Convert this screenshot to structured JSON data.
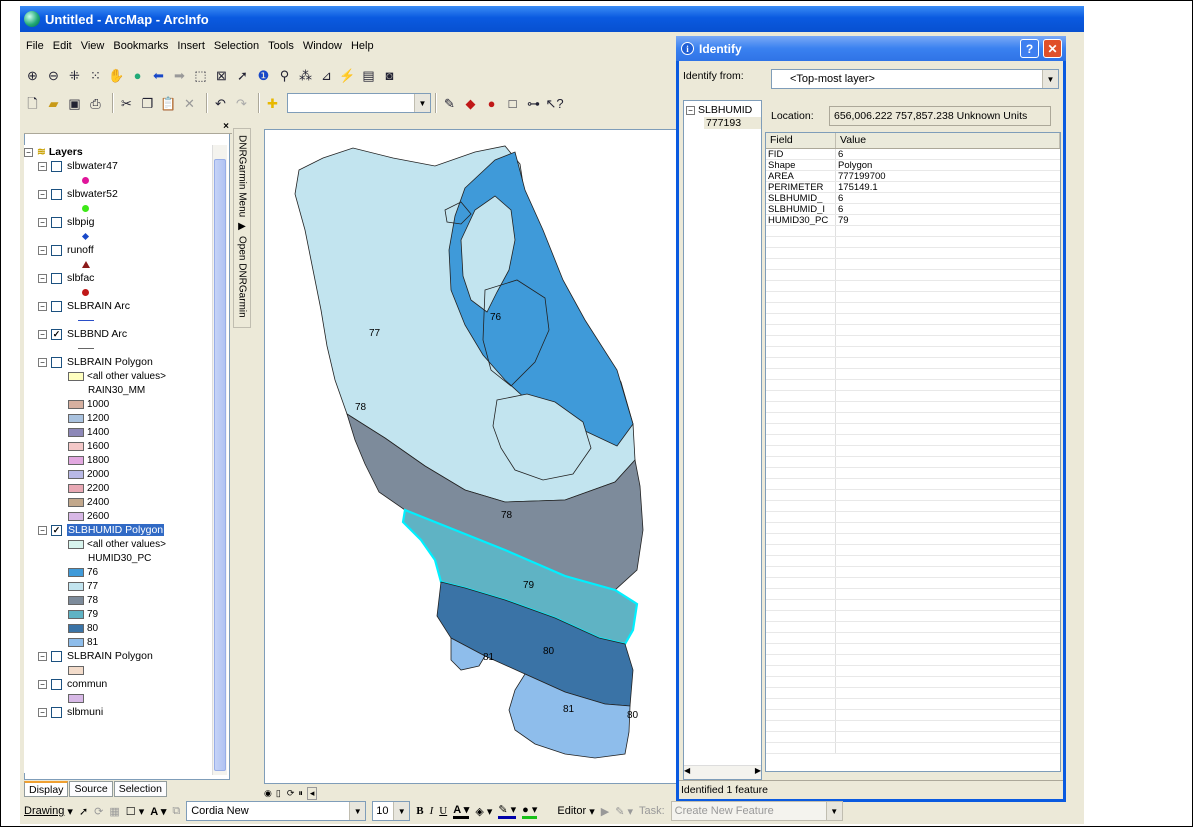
{
  "window": {
    "title": "Untitled - ArcMap - ArcInfo"
  },
  "menu": [
    "File",
    "Edit",
    "View",
    "Bookmarks",
    "Insert",
    "Selection",
    "Tools",
    "Window",
    "Help"
  ],
  "toc": {
    "root": "Layers",
    "layers": [
      {
        "name": "slbwater47",
        "checked": false,
        "symbol": "point",
        "color": "#e0159a"
      },
      {
        "name": "slbwater52",
        "checked": false,
        "symbol": "point",
        "color": "#3ee818"
      },
      {
        "name": "slbpig",
        "checked": false,
        "symbol": "diamond",
        "color": "#1848c8"
      },
      {
        "name": "runoff",
        "checked": false,
        "symbol": "triangle",
        "color": "#8b1a1a"
      },
      {
        "name": "slbfac",
        "checked": false,
        "symbol": "point",
        "color": "#c01818"
      },
      {
        "name": "SLBRAIN Arc",
        "checked": false,
        "symbol": "line",
        "color": "#2a4ec8"
      },
      {
        "name": "SLBBND Arc",
        "checked": true,
        "symbol": "line",
        "color": "#666666"
      }
    ],
    "rain": {
      "name": "SLBRAIN Polygon",
      "other": "<all other values>",
      "field": "RAIN30_MM",
      "classes": [
        {
          "label": "1000",
          "color": "#d6b0a0"
        },
        {
          "label": "1200",
          "color": "#a9c2df"
        },
        {
          "label": "1400",
          "color": "#8d88b8"
        },
        {
          "label": "1600",
          "color": "#f4c8c8"
        },
        {
          "label": "1800",
          "color": "#e2a8e0"
        },
        {
          "label": "2000",
          "color": "#b9b9e6"
        },
        {
          "label": "2200",
          "color": "#e8a8b4"
        },
        {
          "label": "2400",
          "color": "#c2a88c"
        },
        {
          "label": "2600",
          "color": "#d8b8e6"
        }
      ]
    },
    "humid": {
      "name": "SLBHUMID Polygon",
      "other": "<all other values>",
      "field": "HUMID30_PC",
      "classes": [
        {
          "label": "76",
          "color": "#3f9ad9"
        },
        {
          "label": "77",
          "color": "#c2e4ef"
        },
        {
          "label": "78",
          "color": "#7d8b9b"
        },
        {
          "label": "79",
          "color": "#5fb3c4"
        },
        {
          "label": "80",
          "color": "#3a73a6"
        },
        {
          "label": "81",
          "color": "#8ebdeb"
        }
      ]
    },
    "rain2": {
      "name": "SLBRAIN Polygon",
      "color": "#f3dccb"
    },
    "commun": {
      "name": "commun",
      "color": "#d7b8e6"
    },
    "slbmuni": {
      "name": "slbmuni"
    },
    "tabs": [
      "Display",
      "Source",
      "Selection"
    ]
  },
  "dnr": {
    "menu": "DNRGarmin Menu",
    "open": "Open DNRGarmin"
  },
  "map": {
    "labels": [
      "77",
      "76",
      "78",
      "79",
      "80",
      "81",
      "78",
      "81",
      "80"
    ]
  },
  "identify": {
    "title": "Identify",
    "from_label": "Identify from:",
    "from_value": "<Top-most layer>",
    "tree_root": "SLBHUMID",
    "tree_child": "777193",
    "location_label": "Location:",
    "location_value": "656,006.222  757,857.238 Unknown Units",
    "col_field": "Field",
    "col_value": "Value",
    "rows": [
      {
        "field": "FID",
        "value": "6"
      },
      {
        "field": "Shape",
        "value": "Polygon"
      },
      {
        "field": "AREA",
        "value": "777199700"
      },
      {
        "field": "PERIMETER",
        "value": "175149.1"
      },
      {
        "field": "SLBHUMID_",
        "value": "6"
      },
      {
        "field": "SLBHUMID_I",
        "value": "6"
      },
      {
        "field": "HUMID30_PC",
        "value": "79"
      }
    ],
    "status": "Identified 1 feature"
  },
  "drawbar": {
    "drawing": "Drawing",
    "font": "Cordia New",
    "size": "10",
    "editor": "Editor",
    "task_label": "Task:",
    "task_value": "Create New Feature"
  }
}
